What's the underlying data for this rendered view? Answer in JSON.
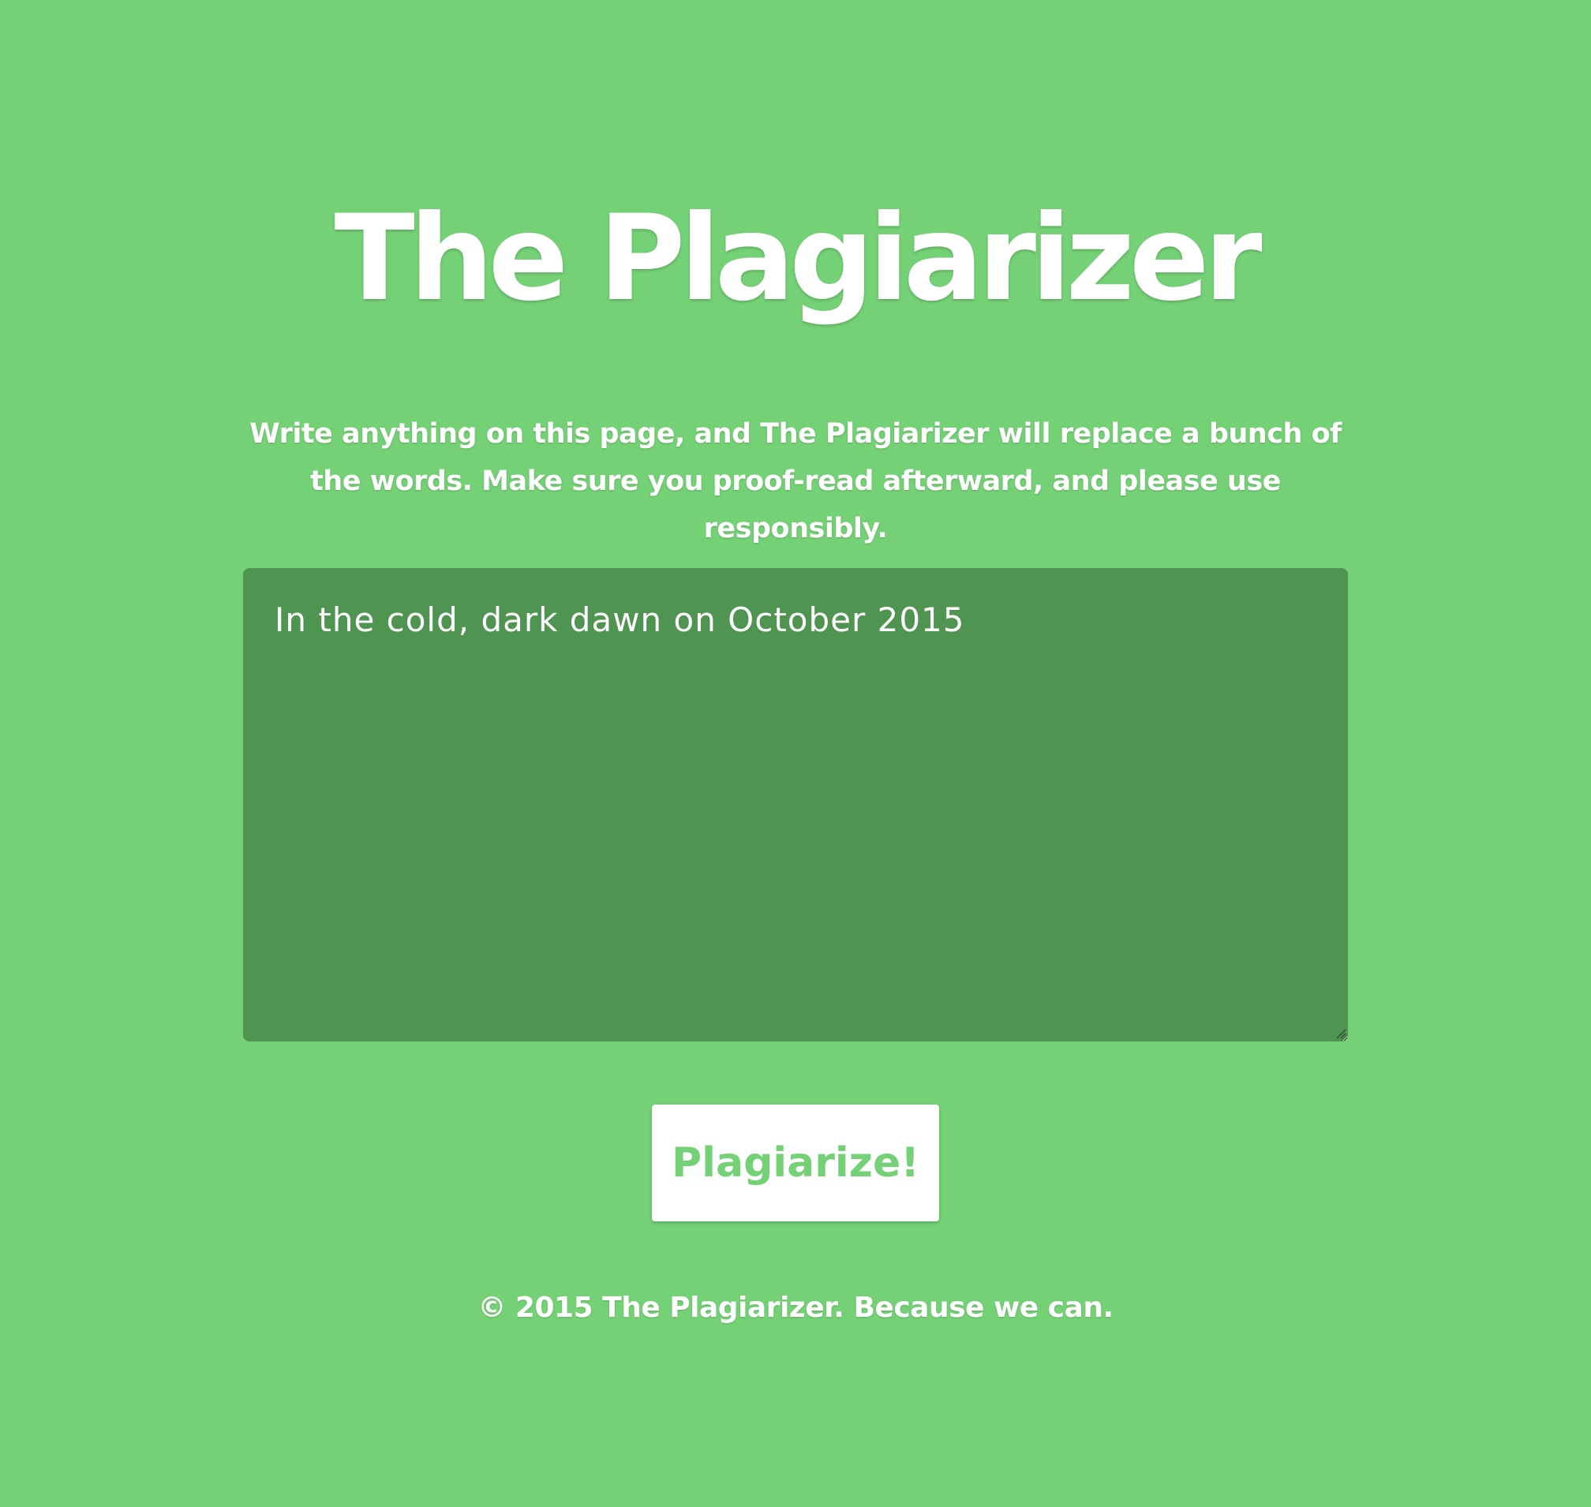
{
  "header": {
    "title": "The Plagiarizer",
    "description": "Write anything on this page, and The Plagiarizer will replace a bunch of the words. Make sure you proof-read afterward, and please use responsibly."
  },
  "editor": {
    "value": "In the cold, dark dawn on October 2015"
  },
  "actions": {
    "submit_label": "Plagiarize!"
  },
  "footer": {
    "text": "© 2015 The Plagiarizer. Because we can."
  },
  "colors": {
    "background": "#74d175",
    "editor_background": "#509451",
    "button_background": "#ffffff",
    "button_text": "#74d175",
    "text": "#ffffff"
  }
}
